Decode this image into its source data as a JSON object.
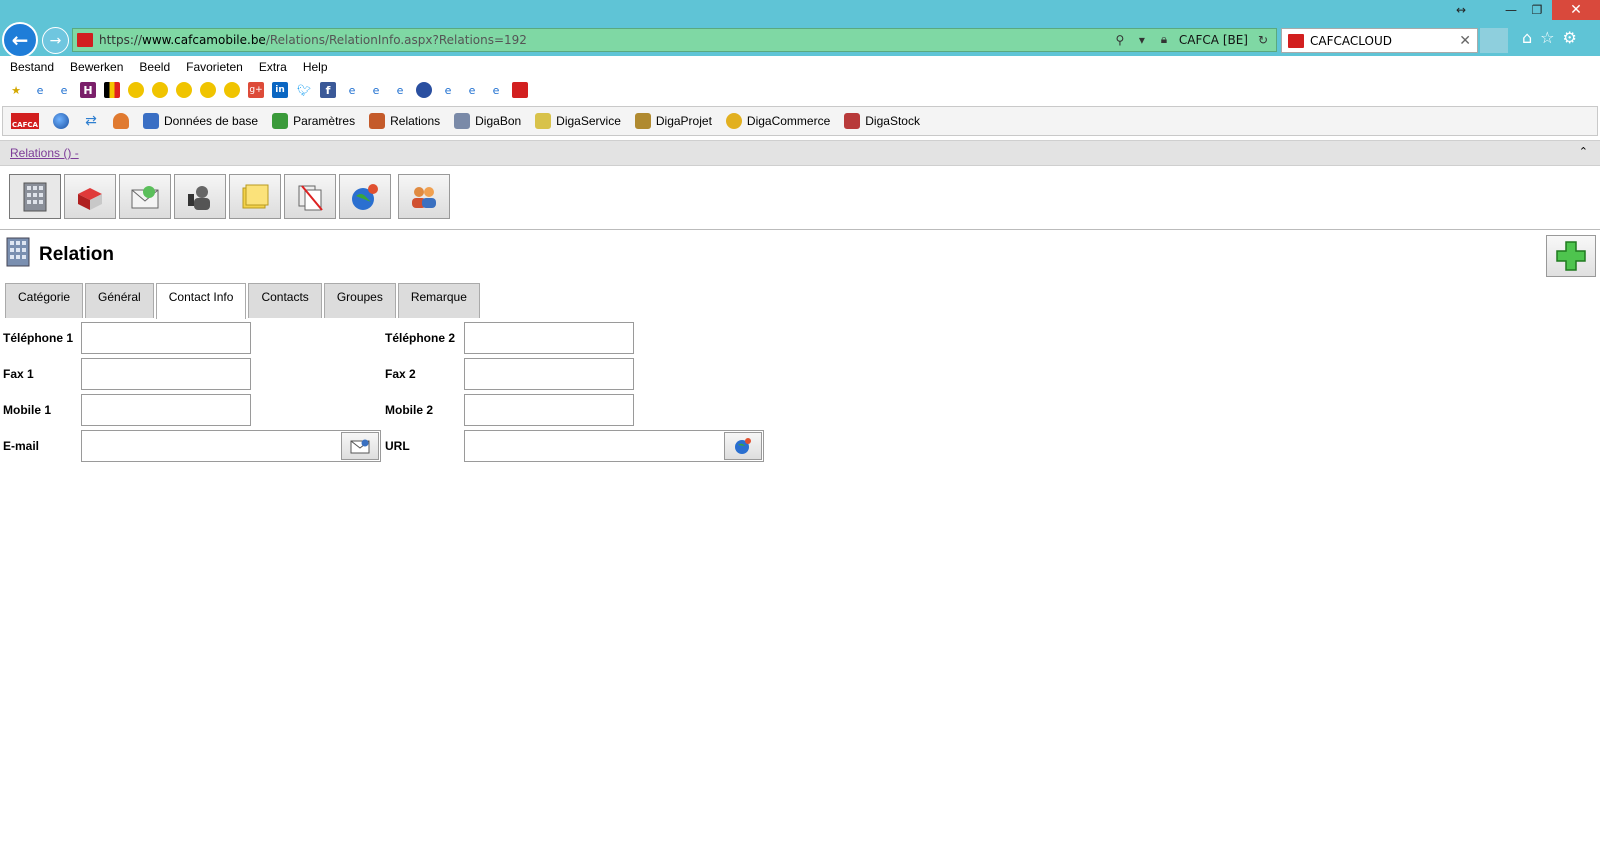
{
  "browser": {
    "url_scheme": "https://",
    "url_host": "www.cafcamobile.be",
    "url_path": "/Relations/RelationInfo.aspx?Relations=192",
    "site_identity": "CAFCA [BE]",
    "tab_title": "CAFCACLOUD",
    "window_controls": {
      "resize": "↔",
      "minimize": "—",
      "maximize": "❐",
      "close": "✕"
    }
  },
  "menubar": [
    "Bestand",
    "Bewerken",
    "Beeld",
    "Favorieten",
    "Extra",
    "Help"
  ],
  "app_toolbar": {
    "items": [
      {
        "label": "Données de base",
        "color": "#3a6fc4"
      },
      {
        "label": "Paramètres",
        "color": "#3a9a3a"
      },
      {
        "label": "Relations",
        "color": "#c45a2a"
      },
      {
        "label": "DigaBon",
        "color": "#7a8aa8"
      },
      {
        "label": "DigaService",
        "color": "#d8c24a"
      },
      {
        "label": "DigaProjet",
        "color": "#b08a30"
      },
      {
        "label": "DigaCommerce",
        "color": "#e2b020"
      },
      {
        "label": "DigaStock",
        "color": "#b83a3a"
      }
    ],
    "logo_text": "CAFCA"
  },
  "relations_bar": {
    "link": "Relations () -",
    "collapse": "⌃"
  },
  "page": {
    "title": "Relation"
  },
  "tabs": [
    "Catégorie",
    "Général",
    "Contact Info",
    "Contacts",
    "Groupes",
    "Remarque"
  ],
  "active_tab": "Contact Info",
  "form": {
    "telephone1": {
      "label": "Téléphone 1",
      "value": ""
    },
    "telephone2": {
      "label": "Téléphone 2",
      "value": ""
    },
    "fax1": {
      "label": "Fax 1",
      "value": ""
    },
    "fax2": {
      "label": "Fax 2",
      "value": ""
    },
    "mobile1": {
      "label": "Mobile 1",
      "value": ""
    },
    "mobile2": {
      "label": "Mobile 2",
      "value": ""
    },
    "email": {
      "label": "E-mail",
      "value": ""
    },
    "url": {
      "label": "URL",
      "value": ""
    }
  }
}
